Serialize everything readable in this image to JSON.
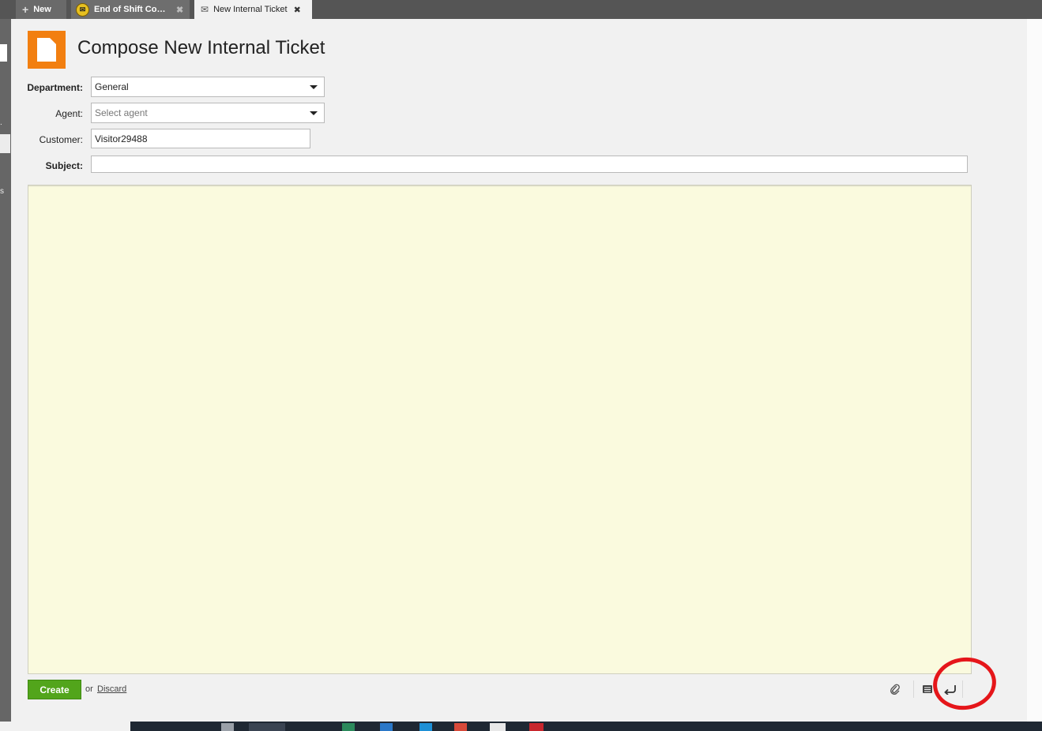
{
  "tabs": {
    "new_label": "New",
    "eos_label": "End of Shift Com…",
    "active_label": "New Internal Ticket"
  },
  "header": {
    "title": "Compose New Internal Ticket"
  },
  "form": {
    "department_label": "Department:",
    "department_value": "General",
    "agent_label": "Agent:",
    "agent_placeholder": "Select agent",
    "customer_label": "Customer:",
    "customer_value": "Visitor29488",
    "subject_label": "Subject:",
    "subject_value": ""
  },
  "footer": {
    "create_label": "Create",
    "or_label": "or",
    "discard_label": "Discard"
  },
  "colors": {
    "accent_orange": "#f27f10",
    "create_green": "#52a51b",
    "editor_bg": "#fafade",
    "annotation_red": "#e5161a"
  },
  "icons": {
    "new_tab": "plus-icon",
    "eos_tab": "mail-badge-icon",
    "active_tab": "envelope-pen-icon",
    "page": "document-icon",
    "attach": "paperclip-icon",
    "snippets": "stack-icon",
    "return": "return-arrow-icon"
  }
}
